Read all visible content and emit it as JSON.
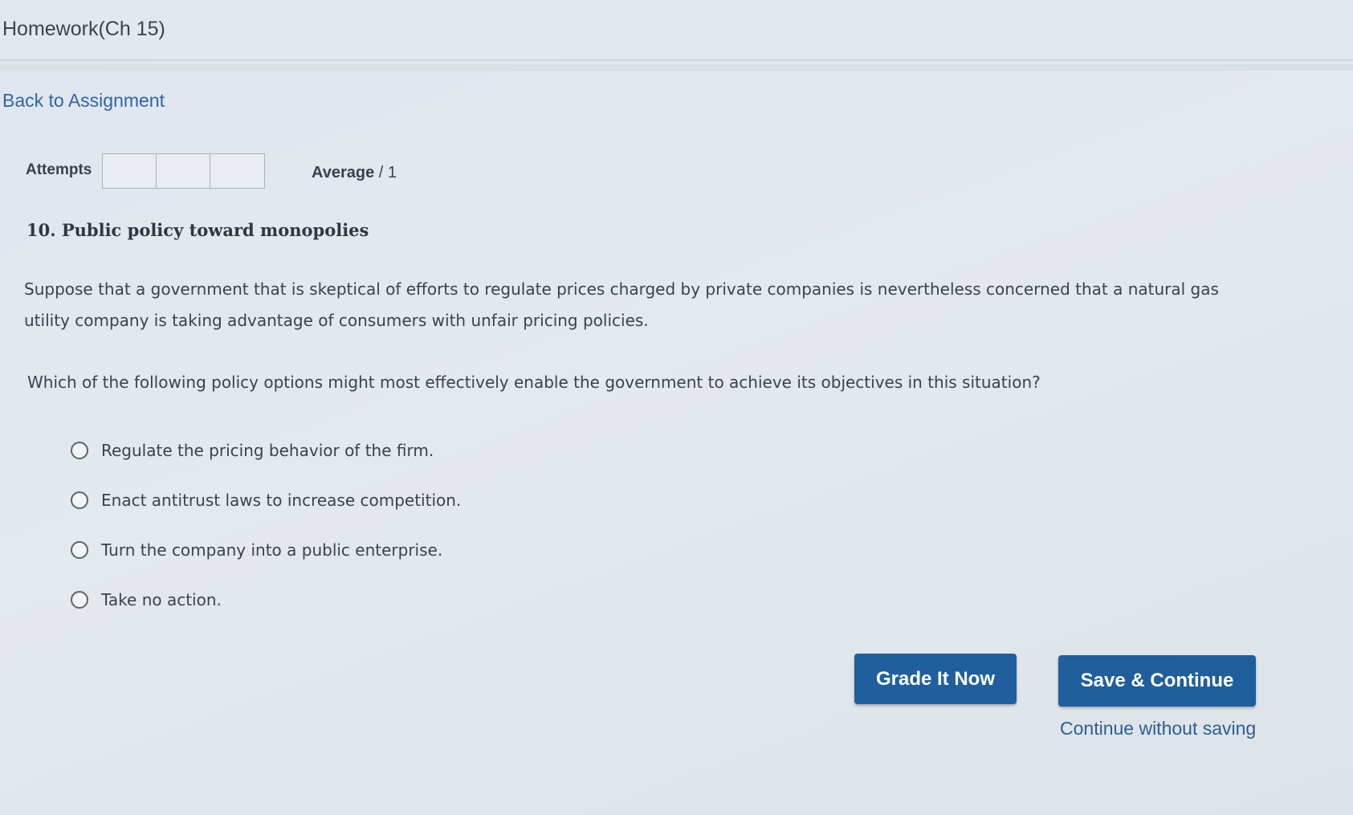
{
  "header": {
    "title": "Homework(Ch 15)"
  },
  "nav": {
    "back_label": "Back to Assignment"
  },
  "status": {
    "attempts_label": "Attempts",
    "attempt_boxes": [
      "",
      "",
      ""
    ],
    "average_label": "Average",
    "average_value": "/ 1"
  },
  "question": {
    "title": "10. Public policy toward monopolies",
    "scenario_line1": "Suppose that a government that is skeptical of efforts to regulate prices charged by private companies is nevertheless concerned that a natural gas",
    "scenario_line2": "utility company is taking advantage of consumers with unfair pricing policies.",
    "prompt": "Which of the following policy options might most effectively enable the government to achieve its objectives in this situation?",
    "options": [
      {
        "label": "Regulate the pricing behavior of the firm.",
        "selected": false
      },
      {
        "label": "Enact antitrust laws to increase competition.",
        "selected": false
      },
      {
        "label": "Turn the company into a public enterprise.",
        "selected": false
      },
      {
        "label": "Take no action.",
        "selected": false
      }
    ]
  },
  "actions": {
    "grade_label": "Grade It Now",
    "save_label": "Save & Continue",
    "continue_label": "Continue without saving"
  },
  "colors": {
    "button_bg": "#1f5f9e",
    "link": "#2d67a8"
  }
}
